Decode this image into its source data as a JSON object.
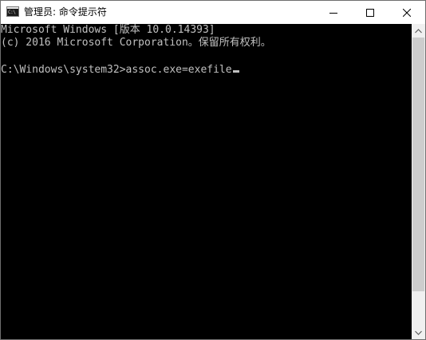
{
  "window": {
    "title": "管理员: 命令提示符",
    "app_icon": "cmd-icon",
    "icon_text": "C:\\"
  },
  "controls": {
    "minimize_icon": "minimize-icon",
    "maximize_icon": "maximize-icon",
    "close_icon": "close-icon"
  },
  "console": {
    "lines": [
      "Microsoft Windows [版本 10.0.14393]",
      "(c) 2016 Microsoft Corporation。保留所有权利。",
      "",
      "C:\\Windows\\system32>assoc.exe=exefile"
    ],
    "text_color": "#c0c0c0",
    "background": "#000000"
  },
  "scrollbar": {
    "up_icon": "scroll-up-arrow-icon",
    "down_icon": "scroll-down-arrow-icon"
  }
}
